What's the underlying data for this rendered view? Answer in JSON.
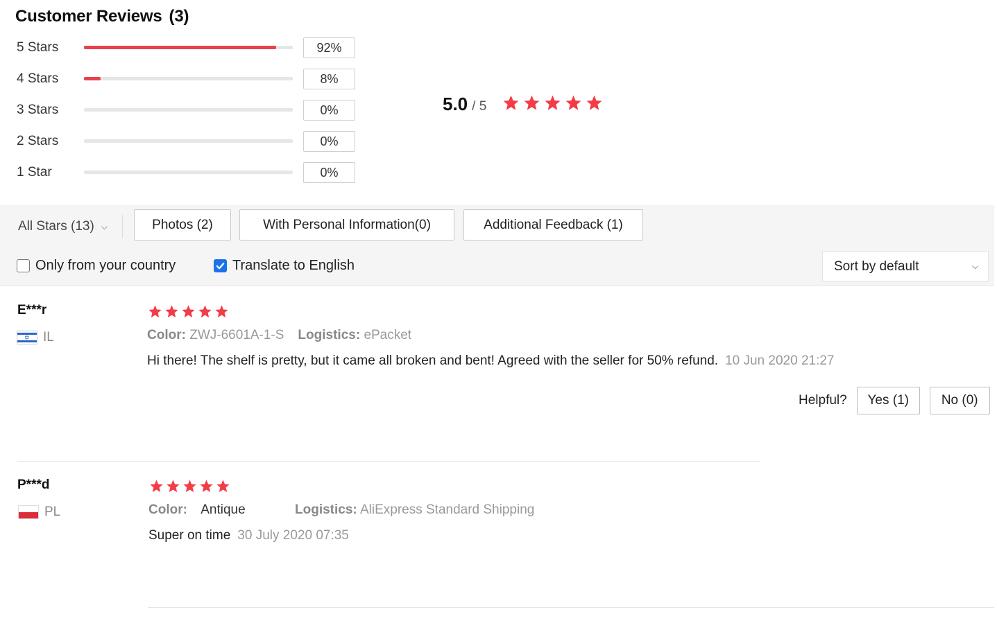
{
  "header": {
    "title": "Customer Reviews",
    "count": "(3)"
  },
  "distribution": [
    {
      "label": "5 Stars",
      "percent": "92%",
      "fill": 0.92
    },
    {
      "label": "4 Stars",
      "percent": "8%",
      "fill": 0.08
    },
    {
      "label": "3 Stars",
      "percent": "0%",
      "fill": 0
    },
    {
      "label": "2 Stars",
      "percent": "0%",
      "fill": 0
    },
    {
      "label": "1 Star",
      "percent": "0%",
      "fill": 0
    }
  ],
  "average": {
    "score": "5.0",
    "total": "/ 5",
    "stars": 5
  },
  "filters": {
    "all_stars": "All Stars (13)",
    "photos": "Photos (2)",
    "personal": "With Personal Information(0)",
    "feedback": "Additional Feedback (1)",
    "only_country": "Only from your country",
    "only_country_checked": false,
    "translate": "Translate to English",
    "translate_checked": true,
    "sort": "Sort by default"
  },
  "reviews": [
    {
      "name": "E***r",
      "country": "IL",
      "stars": 5,
      "color_key": "Color:",
      "color_val": "ZWJ-6601A-1-S",
      "logistics_key": "Logistics:",
      "logistics_val": "ePacket",
      "text": "Hi there! The shelf is pretty, but it came all broken and bent! Agreed with the seller for 50% refund.",
      "date": "10 Jun 2020 21:27",
      "helpful_label": "Helpful?",
      "yes": "Yes (1)",
      "no": "No (0)"
    },
    {
      "name": "P***d",
      "country": "PL",
      "stars": 5,
      "color_key": "Color:",
      "color_val": "Antique",
      "logistics_key": "Logistics:",
      "logistics_val": "AliExpress Standard Shipping",
      "text": "Super on time",
      "date": "30 July 2020 07:35"
    }
  ],
  "colors": {
    "accent": "#e8414a",
    "star": "#f23c48",
    "check": "#1a73e8"
  }
}
